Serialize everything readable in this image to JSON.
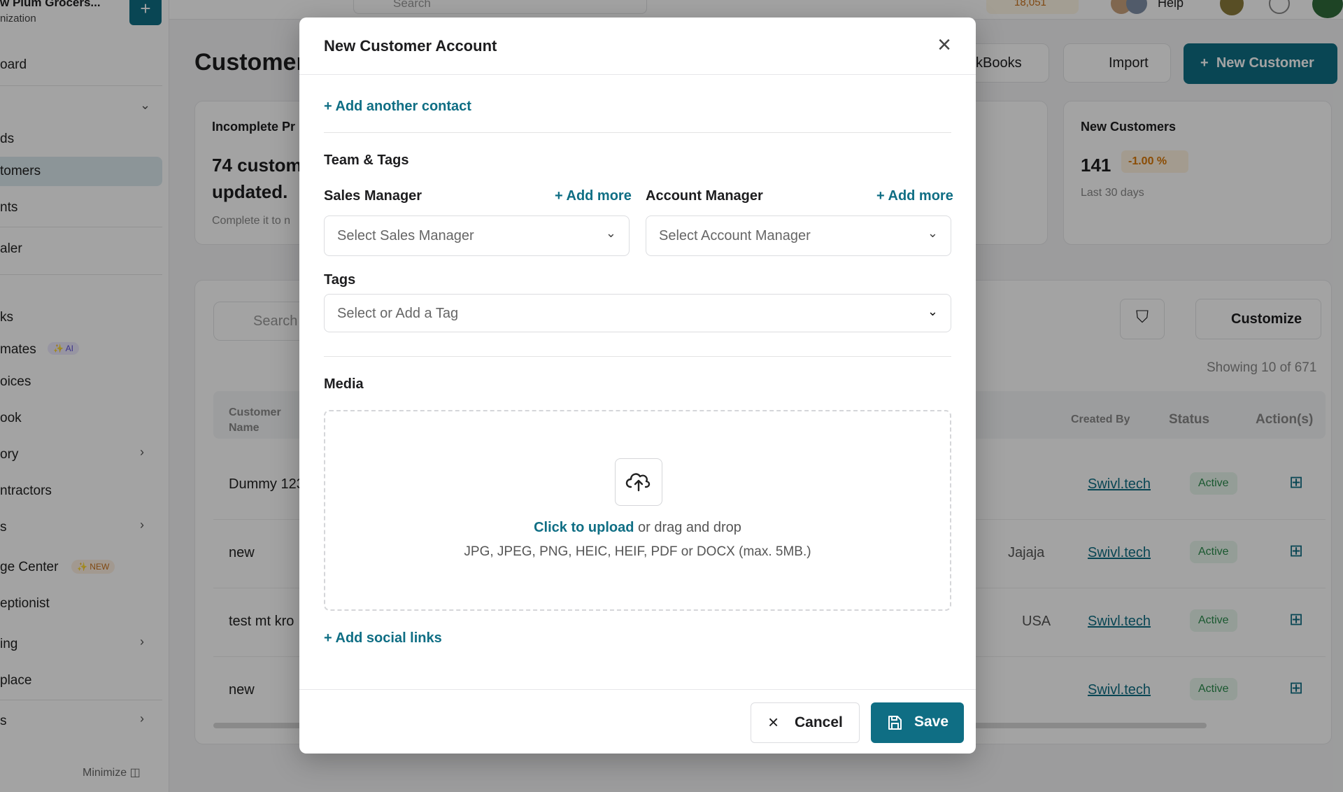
{
  "sidebar": {
    "org_name": "w Plum Grocers...",
    "org_sub": "nization",
    "items": [
      {
        "label": "oard"
      },
      {
        "label": "ds"
      },
      {
        "label": "tomers"
      },
      {
        "label": "nts"
      },
      {
        "label": "aler"
      },
      {
        "label": "ks"
      },
      {
        "label": "mates"
      },
      {
        "label": "oices"
      },
      {
        "label": "ook"
      },
      {
        "label": "ory"
      },
      {
        "label": "ntractors"
      },
      {
        "label": "s"
      },
      {
        "label": "ge Center"
      },
      {
        "label": "eptionist"
      },
      {
        "label": "ing"
      },
      {
        "label": "place"
      },
      {
        "label": "s"
      }
    ],
    "ai_badge": "✨ AI",
    "new_badge": "✨ NEW",
    "minimize_label": "Minimize"
  },
  "topbar": {
    "search_placeholder": "Search",
    "coins": "18,051",
    "help": "Help"
  },
  "page": {
    "title": "Customers",
    "quickbooks_label": "ckBooks",
    "import_label": "Import",
    "new_customer_label": "New Customer",
    "card_incomplete_title": "Incomplete Pr",
    "card_incomplete_big": "74 custom updated.",
    "card_incomplete_small": "Complete it to n",
    "card_new_title": "New Customers",
    "card_new_value": "141",
    "card_new_delta": "-1.00 %",
    "card_new_period": "Last 30 days",
    "table_search_placeholder": "Search",
    "customize_label": "Customize",
    "showing": "Showing 10 of 671",
    "columns": {
      "name": "Customer Name",
      "created_by": "Created By",
      "status": "Status",
      "actions": "Action(s)"
    },
    "rows": [
      {
        "name": "Dummy 123",
        "extra": "",
        "created_by": "Swivl.tech",
        "status": "Active"
      },
      {
        "name": "new",
        "extra": "Jajaja",
        "created_by": "Swivl.tech",
        "status": "Active"
      },
      {
        "name": "test mt kro",
        "extra": "USA",
        "created_by": "Swivl.tech",
        "status": "Active"
      },
      {
        "name": "new",
        "extra": "",
        "created_by": "Swivl.tech",
        "status": "Active"
      }
    ]
  },
  "modal": {
    "title": "New Customer Account",
    "add_contact": "+ Add another contact",
    "team_tags_heading": "Team & Tags",
    "sales_manager_label": "Sales Manager",
    "account_manager_label": "Account Manager",
    "add_more": "+ Add more",
    "sales_manager_placeholder": "Select Sales Manager",
    "account_manager_placeholder": "Select Account Manager",
    "tags_label": "Tags",
    "tags_placeholder": "Select or Add a Tag",
    "media_heading": "Media",
    "upload_cta": "Click to upload",
    "upload_rest": " or drag and drop",
    "upload_formats": "JPG, JPEG, PNG, HEIC, HEIF, PDF or DOCX (max. 5MB.)",
    "add_social": "+ Add social links",
    "cancel_label": "Cancel",
    "save_label": "Save"
  },
  "colors": {
    "accent": "#0f6e84",
    "active_green": "#2a8a4b",
    "warning": "#d97706"
  }
}
